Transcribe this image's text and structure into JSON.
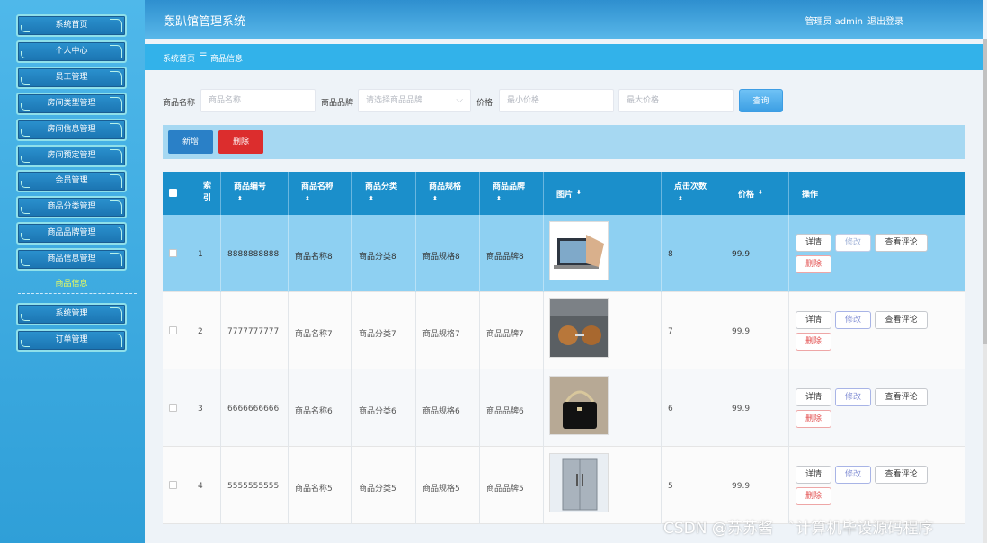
{
  "header": {
    "title": "轰趴馆管理系统",
    "user": "管理员 admin",
    "logout": "退出登录"
  },
  "breadcrumb": {
    "home": "系统首页",
    "sep": "☰",
    "current": "商品信息"
  },
  "sidebar": {
    "items": [
      "系统首页",
      "个人中心",
      "员工管理",
      "房间类型管理",
      "房间信息管理",
      "房间预定管理",
      "会员管理",
      "商品分类管理",
      "商品品牌管理",
      "商品信息管理"
    ],
    "active_sub": "商品信息",
    "items2": [
      "系统管理",
      "订单管理"
    ]
  },
  "search": {
    "name_label": "商品名称",
    "name_placeholder": "商品名称",
    "brand_label": "商品品牌",
    "brand_placeholder": "请选择商品品牌",
    "price_label": "价格",
    "min_placeholder": "最小价格",
    "max_placeholder": "最大价格",
    "query": "查询"
  },
  "toolbar": {
    "add": "新增",
    "delete": "删除"
  },
  "table": {
    "headers": [
      "索引",
      "商品编号",
      "商品名称",
      "商品分类",
      "商品规格",
      "商品品牌",
      "图片",
      "点击次数",
      "价格",
      "操作"
    ],
    "rows": [
      {
        "idx": "1",
        "code": "8888888888",
        "name": "商品名称8",
        "cat": "商品分类8",
        "spec": "商品规格8",
        "brand": "商品品牌8",
        "clicks": "8",
        "price": "99.9",
        "img": "laptop-image"
      },
      {
        "idx": "2",
        "code": "7777777777",
        "name": "商品名称7",
        "cat": "商品分类7",
        "spec": "商品规格7",
        "brand": "商品品牌7",
        "clicks": "7",
        "price": "99.9",
        "img": "sunglasses-image"
      },
      {
        "idx": "3",
        "code": "6666666666",
        "name": "商品名称6",
        "cat": "商品分类6",
        "spec": "商品规格6",
        "brand": "商品品牌6",
        "clicks": "6",
        "price": "99.9",
        "img": "handbag-image"
      },
      {
        "idx": "4",
        "code": "5555555555",
        "name": "商品名称5",
        "cat": "商品分类5",
        "spec": "商品规格5",
        "brand": "商品品牌5",
        "clicks": "5",
        "price": "99.9",
        "img": "fridge-image"
      }
    ],
    "ops": {
      "detail": "详情",
      "edit": "修改",
      "comments": "查看评论",
      "delete": "删除"
    }
  },
  "watermark": "CSDN @苏苏酱　`计算机毕设源码程序"
}
